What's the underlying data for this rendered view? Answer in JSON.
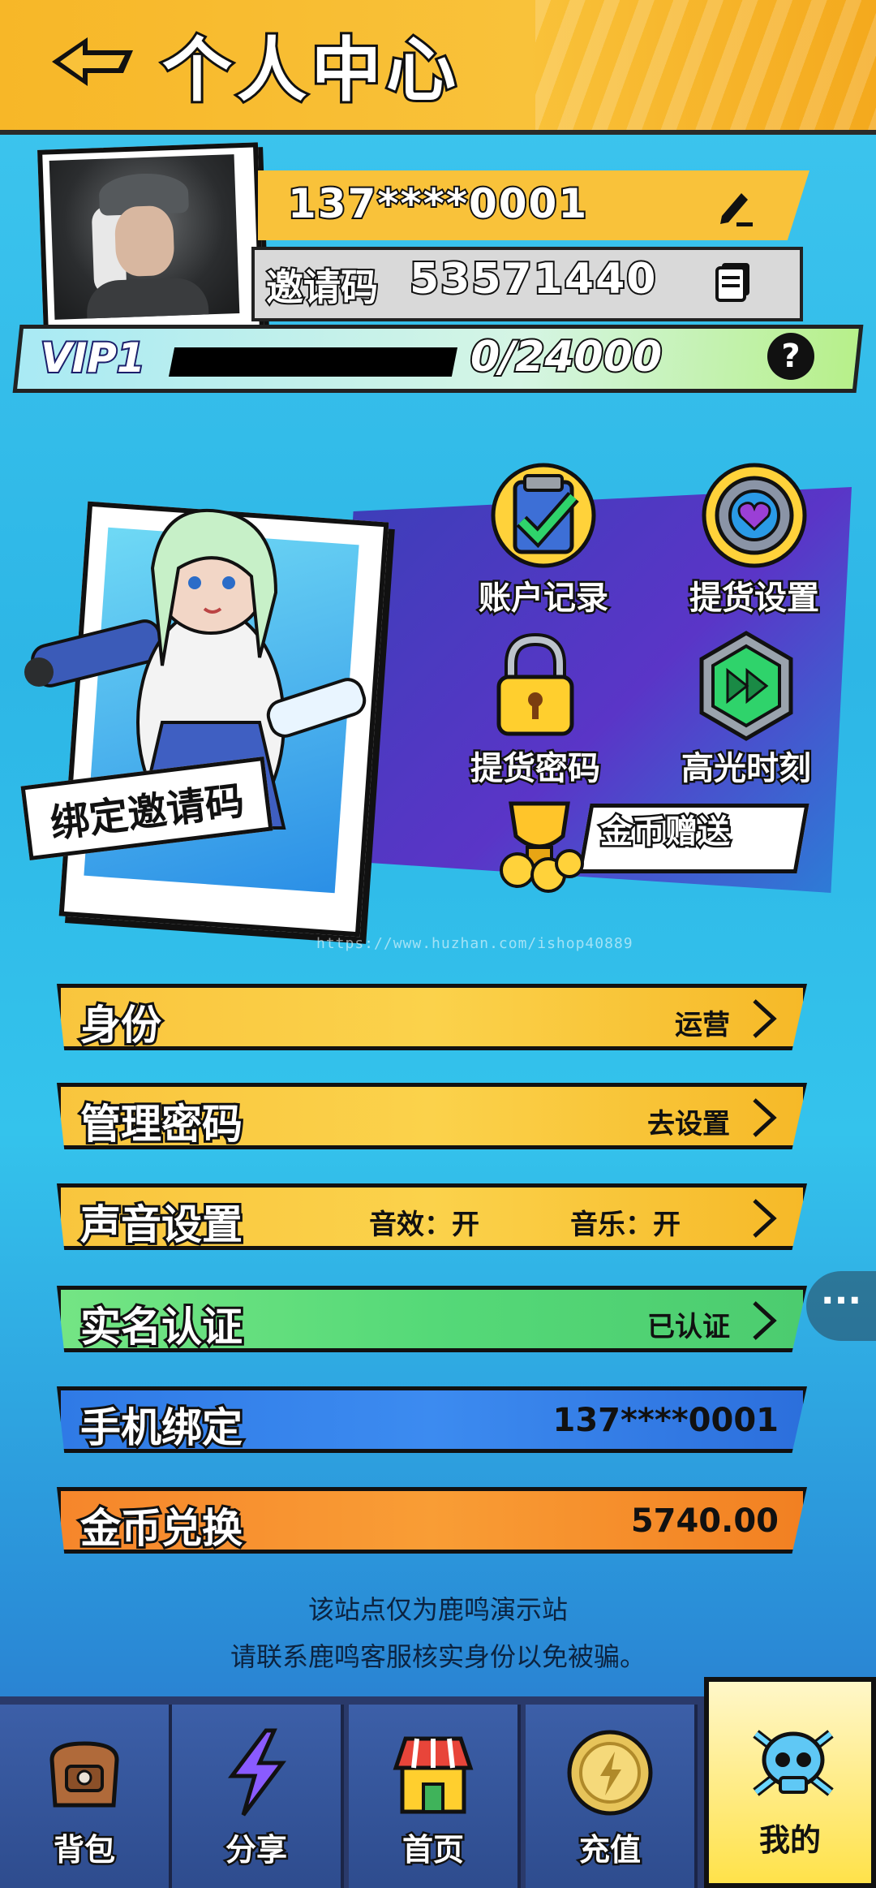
{
  "header": {
    "title": "个人中心"
  },
  "profile": {
    "phone": "137****0001",
    "invite_label": "邀请码",
    "invite_code": "53571440",
    "vip_level": "VIP1",
    "vip_progress_text": "0/24000",
    "vip_progress_fraction": 0,
    "help_symbol": "?"
  },
  "features": {
    "bind_invite": "绑定邀请码",
    "items": [
      {
        "label": "账户记录",
        "icon": "clipboard-check-icon"
      },
      {
        "label": "提货设置",
        "icon": "gear-heart-icon"
      },
      {
        "label": "提货密码",
        "icon": "padlock-icon"
      },
      {
        "label": "高光时刻",
        "icon": "play-forward-icon"
      },
      {
        "label": "金币赠送",
        "icon": "coin-trophy-icon"
      }
    ]
  },
  "watermark": "https://www.huzhan.com/ishop40889",
  "rows": {
    "identity": {
      "label": "身份",
      "value": "运营"
    },
    "admin_password": {
      "label": "管理密码",
      "value": "去设置"
    },
    "sound": {
      "label": "声音设置",
      "effect": "音效：开",
      "music": "音乐：开"
    },
    "realname": {
      "label": "实名认证",
      "value": "已认证"
    },
    "phone_bind": {
      "label": "手机绑定",
      "value": "137****0001"
    },
    "coin_exchange": {
      "label": "金币兑换",
      "value": "5740.00"
    }
  },
  "float_menu": "···",
  "notice": {
    "line1": "该站点仅为鹿鸣演示站",
    "line2": "请联系鹿鸣客服核实身份以免被骗。"
  },
  "nav": {
    "items": [
      {
        "label": "背包",
        "icon": "backpack-icon"
      },
      {
        "label": "分享",
        "icon": "lightning-icon"
      },
      {
        "label": "首页",
        "icon": "shop-icon"
      },
      {
        "label": "充值",
        "icon": "coin-icon"
      },
      {
        "label": "我的",
        "icon": "skull-icon"
      }
    ]
  },
  "colors": {
    "accent_yellow": "#f9c23a",
    "green_row": "#55d978",
    "blue_row": "#3c8bf0",
    "orange_row": "#f99d35"
  }
}
